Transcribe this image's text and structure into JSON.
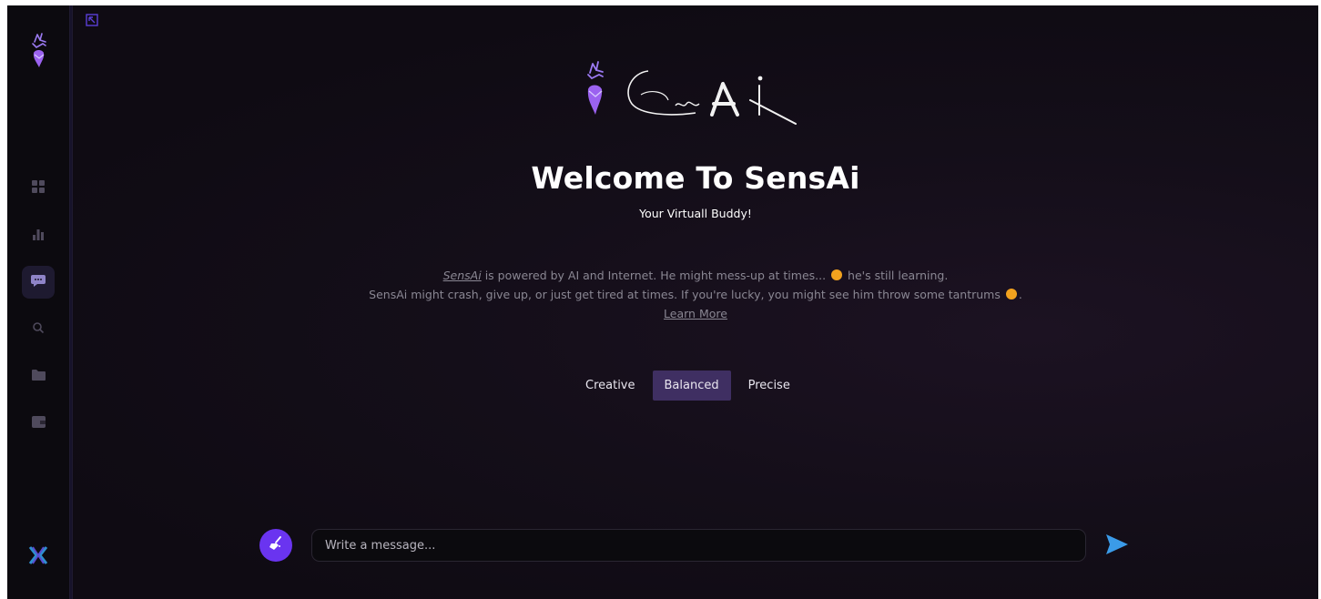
{
  "app": {
    "title": "Welcome To SensAi",
    "subtitle": "Your Virtuall Buddy!",
    "logo_text": "SensAi"
  },
  "sidebar": {
    "items": [
      {
        "name": "dashboard",
        "icon": "grid-icon"
      },
      {
        "name": "analytics",
        "icon": "bar-chart-icon"
      },
      {
        "name": "chat",
        "icon": "chat-bubble-icon",
        "active": true
      },
      {
        "name": "search",
        "icon": "search-icon"
      },
      {
        "name": "files",
        "icon": "folder-icon"
      },
      {
        "name": "wallet",
        "icon": "wallet-icon"
      }
    ],
    "footer_icon": "x-logo-icon"
  },
  "info": {
    "brand": "SensAi",
    "line1_rest": " is powered by AI and Internet. He might mess-up at times... ",
    "line1_end": " he's still learning.",
    "line2": "SensAi might crash, give up, or just get tired at times. If you're lucky, you might see him throw some tantrums ",
    "line2_end": ".",
    "learn_more": "Learn More"
  },
  "modes": {
    "creative": "Creative",
    "balanced": "Balanced",
    "precise": "Precise",
    "selected": "Balanced"
  },
  "composer": {
    "placeholder": "Write a message..."
  },
  "colors": {
    "accent": "#6a34f0",
    "mode_active": "#3f2f62",
    "send": "#3b9be8",
    "background": "#120d17"
  }
}
